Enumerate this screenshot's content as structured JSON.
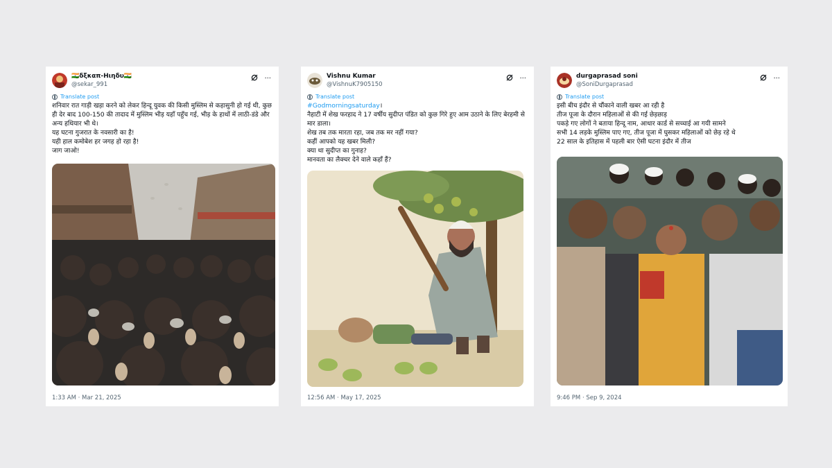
{
  "posts": [
    {
      "display_name": "🇮🇳δξκαπ-Ηιηδυ🇮🇳",
      "handle": "@sekar_991",
      "translate_label": "Translate post",
      "lines": [
        "शनिवार रात गाड़ी खड़ा करने को लेकर हिन्दू युवक की किसी मुस्लिम से कहासुनी हो गई थी, कुछ ही देर बाद 100-150 की तादाद में मुस्लिम भीड़ यहाँ पहुँच गई, भीड़ के हाथों में लाठी-डंडे और अन्य हथियार भी थे।",
        "यह घटना गुजरात के नवसारी का है!",
        "यही हाल कमोबेश हर जगह हो रहा है!",
        "जाग जाओ!"
      ],
      "timestamp": "1:33 AM · Mar 21, 2025",
      "avatar_color": "#c0392b"
    },
    {
      "display_name": "Vishnu Kumar",
      "handle": "@VishnuK7905150",
      "translate_label": "Translate post",
      "hashtag": "#Godmorningsaturday",
      "hashtag_suffix": "।",
      "lines": [
        "नैहाटी में शेख फरहाद ने 17 वर्षीय सुदीप्त पंडित को कुछ गिरे हुए आम उठाने के लिए बेरहमी से मार डाला।",
        "शेख तब तक मारता रहा, जब तक मर नहीं गया?",
        "कहीं आपको यह खबर मिली?",
        "क्या था सुदीप्त का गुनाह?",
        "मानवता का लैक्चर देने वाले कहाँ हैं?"
      ],
      "timestamp": "12:56 AM · May 17, 2025",
      "avatar_color": "#6b5a3a"
    },
    {
      "display_name": "durgaprasad soni",
      "handle": "@SoniDurgaprasad",
      "translate_label": "Translate post",
      "lines": [
        "इसी बीच इंदौर से चौंकाने वाली खबर आ रही है",
        "तीज पूजा के दौरान महिलाओं से की गई छेड़छाड़",
        "पकड़े गए लोगों ने बताया हिन्दू नाम, आधार कार्ड से सच्चाई आ गयी सामने",
        "सभी 14 लड़के मुस्लिम पाए गए, तीज पूजा में घुसकर महिलाओं को छेड़ रहे थे",
        "22 साल के इतिहास में पहली बार ऐसी घटना इंदौर में तीज"
      ],
      "timestamp": "9:46 PM · Sep 9, 2024",
      "avatar_color": "#a93226"
    }
  ],
  "icons": {
    "grok": "grok-icon",
    "more": "more-icon",
    "globe": "globe-icon"
  }
}
